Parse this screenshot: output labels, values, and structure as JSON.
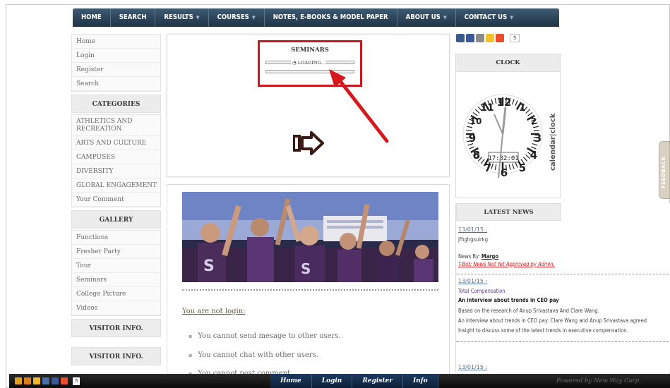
{
  "nav": {
    "items": [
      {
        "label": "HOME",
        "caret": false
      },
      {
        "label": "SEARCH",
        "caret": false
      },
      {
        "label": "RESULTS",
        "caret": true
      },
      {
        "label": "COURSES",
        "caret": true
      },
      {
        "label": "NOTES, E-BOOKS & MODEL PAPER",
        "caret": false
      },
      {
        "label": "ABOUT US",
        "caret": true
      },
      {
        "label": "CONTACT US",
        "caret": true
      }
    ]
  },
  "sidebar": {
    "links": [
      "Home",
      "Login",
      "Register",
      "Search"
    ],
    "categories_title": "CATEGORIES",
    "categories": [
      "ATHLETICS AND RECREATION",
      "ARTS AND CULTURE",
      "CAMPUSES",
      "DIVERSITY",
      "GLOBAL ENGAGEMENT",
      "Your Comment"
    ],
    "gallery_title": "GALLERY",
    "gallery": [
      "Functions",
      "Fresher Party",
      "Tour",
      "Seminars",
      "College Picture",
      "Videos"
    ],
    "visitor_title": "VISITOR INFO.",
    "visitor_title_2": "VISITOR INFO."
  },
  "seminars": {
    "title": "SEMINARS",
    "loading": "LOADING..",
    "highlight_color": "#c8191f"
  },
  "main": {
    "not_login": "You are not login:",
    "bullets": [
      "You cannot send mesage to other users.",
      "You cannot chat with other users.",
      "You cannot post comment"
    ]
  },
  "social": {
    "count": "5"
  },
  "clock": {
    "title": "CLOCK",
    "digital": "17:32:01",
    "brand": "calendar|clock",
    "numbers": [
      "12",
      "1",
      "2",
      "3",
      "4",
      "5",
      "6",
      "7",
      "8",
      "9",
      "10",
      "11"
    ]
  },
  "news": {
    "title": "LATEST NEWS",
    "item1_date": "13/01/15 :",
    "item1_text": "jfhghgsuirkg",
    "news_by_label": "News By:",
    "news_by_name": "Margo",
    "approval": "T-Bot: News Not Yet Approved by Admin.",
    "item2_date": "13/01/15 :",
    "item2_title": "Total Compensation",
    "item2_headline": "An interview about trends in CEO pay",
    "item2_line1": "Based on the research of Anup Srivastava And Clare Wang.",
    "item2_line2": "An interview about trends in CEO pay: Clare Wang and Anup Srivastava agreed",
    "item2_line3": "Insight to discuss some of the latest trends in executive compensation.",
    "item3_date": "13/01/15 :"
  },
  "feedback": {
    "label": "FEEDBACK"
  },
  "bottom_bar": {
    "count": "5",
    "links": [
      "Home",
      "Login",
      "Register",
      "Info"
    ],
    "powered": "Powered by New Way Corp."
  }
}
